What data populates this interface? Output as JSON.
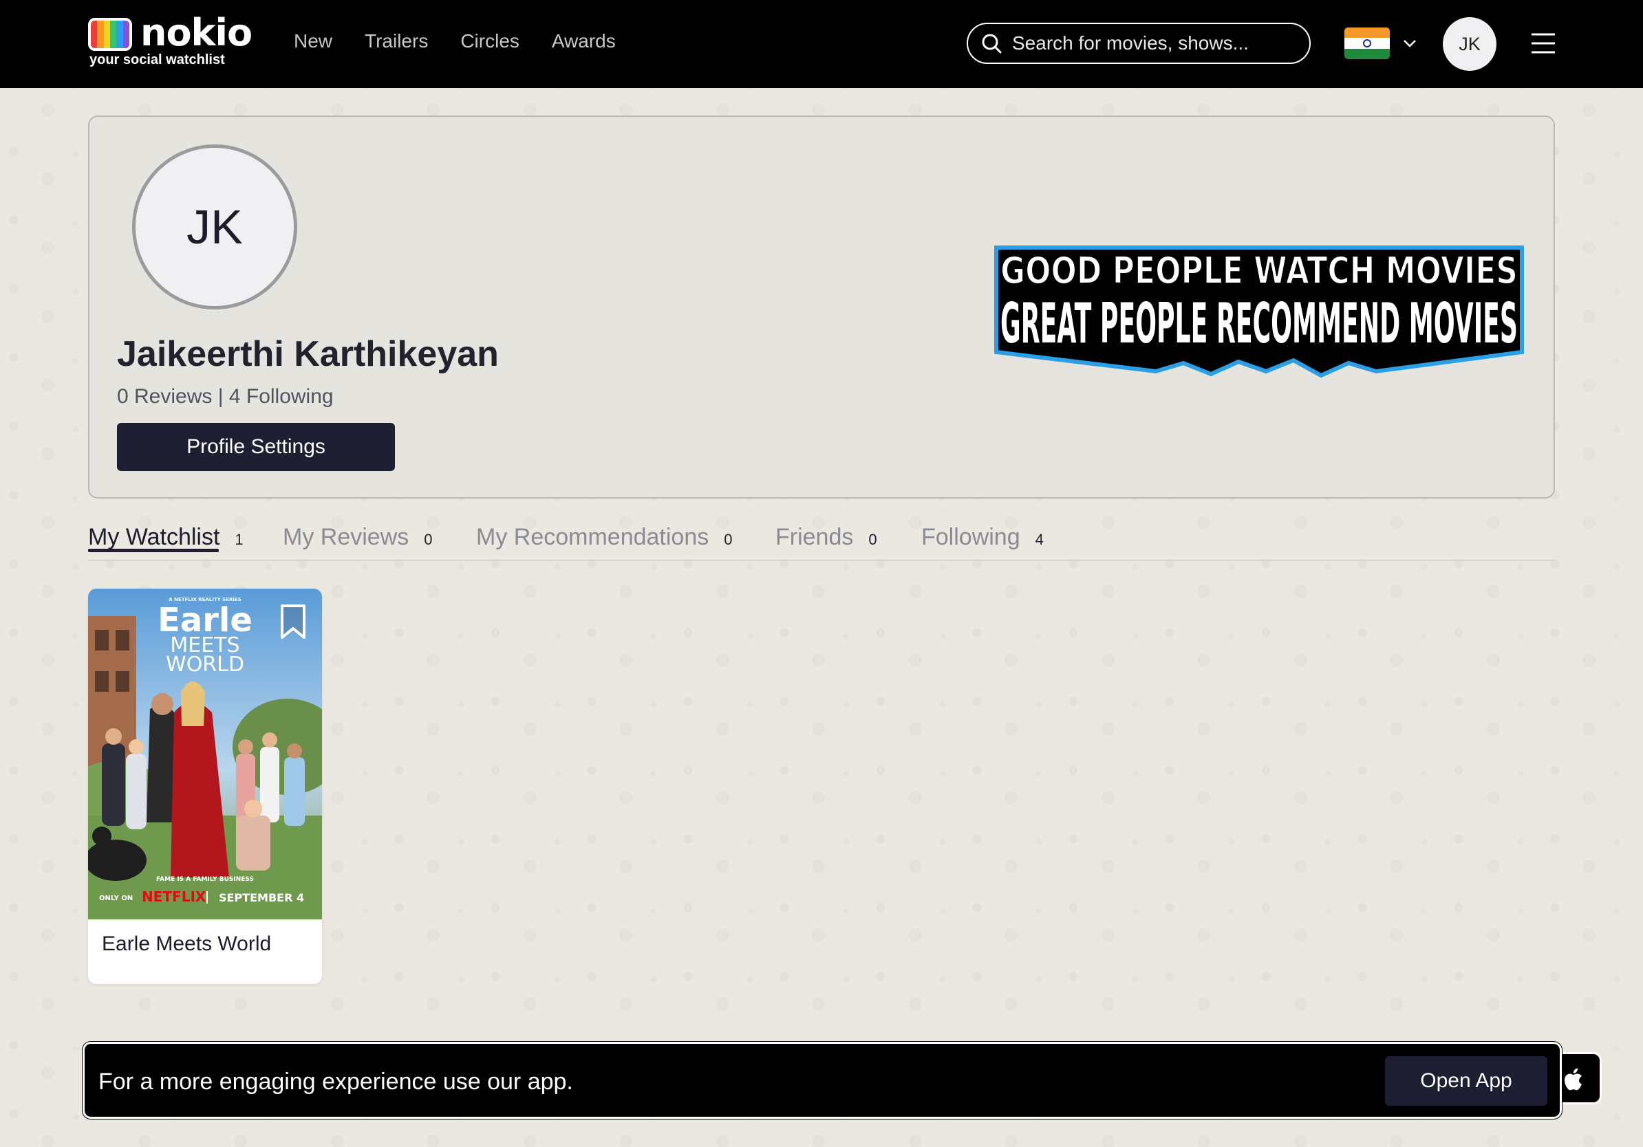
{
  "brand": {
    "name": "nokio",
    "tagline": "your social watchlist",
    "tv_colors": [
      "#ef3e3e",
      "#f39a1f",
      "#f6d21d",
      "#3cc26a",
      "#2a9df4",
      "#8b4fd9"
    ]
  },
  "nav": {
    "items": [
      {
        "label": "New"
      },
      {
        "label": "Trailers"
      },
      {
        "label": "Circles"
      },
      {
        "label": "Awards"
      }
    ]
  },
  "search": {
    "placeholder": "Search for movies, shows..."
  },
  "header": {
    "country_flag_icon": "india-flag-icon",
    "user_initials": "JK"
  },
  "profile": {
    "initials": "JK",
    "name": "Jaikeerthi Karthikeyan",
    "stats": "0 Reviews | 4 Following",
    "settings_label": "Profile Settings",
    "banner_line1": "GOOD PEOPLE WATCH MOVIES",
    "banner_line2": "GREAT PEOPLE RECOMMEND MOVIES",
    "banner_accent": "#2b9fe6"
  },
  "tabs": [
    {
      "label": "My Watchlist",
      "count": "1",
      "active": true
    },
    {
      "label": "My Reviews",
      "count": "0"
    },
    {
      "label": "My Recommendations",
      "count": "0"
    },
    {
      "label": "Friends",
      "count": "0"
    },
    {
      "label": "Following",
      "count": "4"
    }
  ],
  "watchlist": [
    {
      "title": "Earle Meets World",
      "poster": {
        "series_tag": "A NETFLIX REALITY SERIES",
        "title_line1": "Earle",
        "title_line2": "MEETS",
        "title_line3": "WORLD",
        "tagline": "FAME IS A FAMILY BUSINESS",
        "only_on": "ONLY ON",
        "network": "NETFLIX",
        "date": "SEPTEMBER 4"
      }
    }
  ],
  "app_banner": {
    "message": "For a more engaging experience use our app.",
    "button_label": "Open App"
  }
}
